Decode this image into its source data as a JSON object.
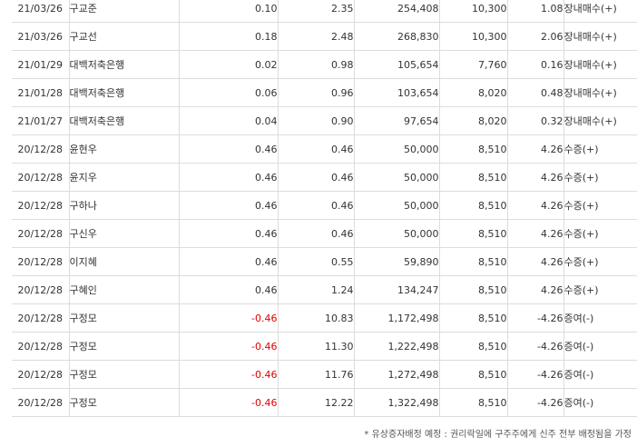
{
  "rows": [
    {
      "date": "21/03/26",
      "name": "구교준",
      "ratio_change": "0.10",
      "ratio_after": "2.35",
      "shares_after": "254,408",
      "price": "10,300",
      "amount": "1.08",
      "type": "장내매수(+)",
      "negative": false
    },
    {
      "date": "21/03/26",
      "name": "구교선",
      "ratio_change": "0.18",
      "ratio_after": "2.48",
      "shares_after": "268,830",
      "price": "10,300",
      "amount": "2.06",
      "type": "장내매수(+)",
      "negative": false
    },
    {
      "date": "21/01/29",
      "name": "대백저축은행",
      "ratio_change": "0.02",
      "ratio_after": "0.98",
      "shares_after": "105,654",
      "price": "7,760",
      "amount": "0.16",
      "type": "장내매수(+)",
      "negative": false
    },
    {
      "date": "21/01/28",
      "name": "대백저축은행",
      "ratio_change": "0.06",
      "ratio_after": "0.96",
      "shares_after": "103,654",
      "price": "8,020",
      "amount": "0.48",
      "type": "장내매수(+)",
      "negative": false
    },
    {
      "date": "21/01/27",
      "name": "대백저축은행",
      "ratio_change": "0.04",
      "ratio_after": "0.90",
      "shares_after": "97,654",
      "price": "8,020",
      "amount": "0.32",
      "type": "장내매수(+)",
      "negative": false
    },
    {
      "date": "20/12/28",
      "name": "윤현우",
      "ratio_change": "0.46",
      "ratio_after": "0.46",
      "shares_after": "50,000",
      "price": "8,510",
      "amount": "4.26",
      "type": "수증(+)",
      "negative": false
    },
    {
      "date": "20/12/28",
      "name": "윤지우",
      "ratio_change": "0.46",
      "ratio_after": "0.46",
      "shares_after": "50,000",
      "price": "8,510",
      "amount": "4.26",
      "type": "수증(+)",
      "negative": false
    },
    {
      "date": "20/12/28",
      "name": "구하나",
      "ratio_change": "0.46",
      "ratio_after": "0.46",
      "shares_after": "50,000",
      "price": "8,510",
      "amount": "4.26",
      "type": "수증(+)",
      "negative": false
    },
    {
      "date": "20/12/28",
      "name": "구신우",
      "ratio_change": "0.46",
      "ratio_after": "0.46",
      "shares_after": "50,000",
      "price": "8,510",
      "amount": "4.26",
      "type": "수증(+)",
      "negative": false
    },
    {
      "date": "20/12/28",
      "name": "이지혜",
      "ratio_change": "0.46",
      "ratio_after": "0.55",
      "shares_after": "59,890",
      "price": "8,510",
      "amount": "4.26",
      "type": "수증(+)",
      "negative": false
    },
    {
      "date": "20/12/28",
      "name": "구혜인",
      "ratio_change": "0.46",
      "ratio_after": "1.24",
      "shares_after": "134,247",
      "price": "8,510",
      "amount": "4.26",
      "type": "수증(+)",
      "negative": false
    },
    {
      "date": "20/12/28",
      "name": "구정모",
      "ratio_change": "-0.46",
      "ratio_after": "10.83",
      "shares_after": "1,172,498",
      "price": "8,510",
      "amount": "-4.26",
      "type": "증여(-)",
      "negative": true
    },
    {
      "date": "20/12/28",
      "name": "구정모",
      "ratio_change": "-0.46",
      "ratio_after": "11.30",
      "shares_after": "1,222,498",
      "price": "8,510",
      "amount": "-4.26",
      "type": "증여(-)",
      "negative": true
    },
    {
      "date": "20/12/28",
      "name": "구정모",
      "ratio_change": "-0.46",
      "ratio_after": "11.76",
      "shares_after": "1,272,498",
      "price": "8,510",
      "amount": "-4.26",
      "type": "증여(-)",
      "negative": true
    },
    {
      "date": "20/12/28",
      "name": "구정모",
      "ratio_change": "-0.46",
      "ratio_after": "12.22",
      "shares_after": "1,322,498",
      "price": "8,510",
      "amount": "-4.26",
      "type": "증여(-)",
      "negative": true
    }
  ],
  "footnote": "* 유상증자배정 예정 : 권리락일에 구주주에게 신주 전부 배정됨을 가정",
  "colors": {
    "negative": "#e00000",
    "text": "#333333",
    "grid": "#dcdcdc"
  }
}
